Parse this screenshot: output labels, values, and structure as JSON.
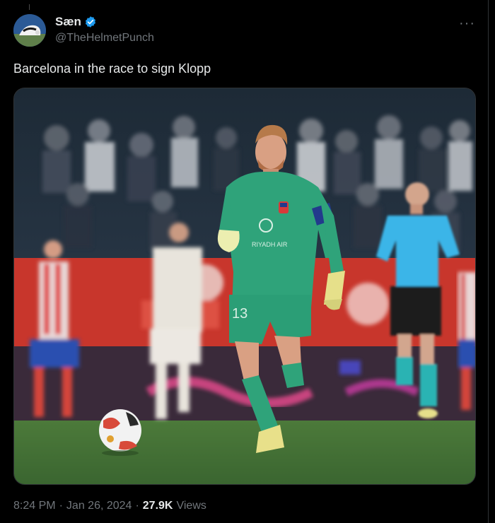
{
  "author": {
    "display_name": "Sæn",
    "handle": "@TheHelmetPunch",
    "verified_icon": "verified-badge-icon",
    "avatar_icon": "avatar"
  },
  "tweet": {
    "text": "Barcelona in the race to sign Klopp",
    "more_icon": "more-options-icon"
  },
  "media": {
    "kind": "photo",
    "jersey_number": "13",
    "jersey_sponsor": "RIYADH AIR"
  },
  "meta": {
    "time": "8:24 PM",
    "sep1": "·",
    "date": "Jan 26, 2024",
    "sep2": "·",
    "views_count": "27.9K",
    "views_label": "Views"
  },
  "colors": {
    "background": "#000000",
    "text_primary": "#e7e9ea",
    "text_secondary": "#71767b",
    "verified": "#1d9bf0",
    "keeper_kit": "#2fa37a",
    "referee_kit": "#3bb5e8",
    "pitch": "#3f6b2f"
  }
}
